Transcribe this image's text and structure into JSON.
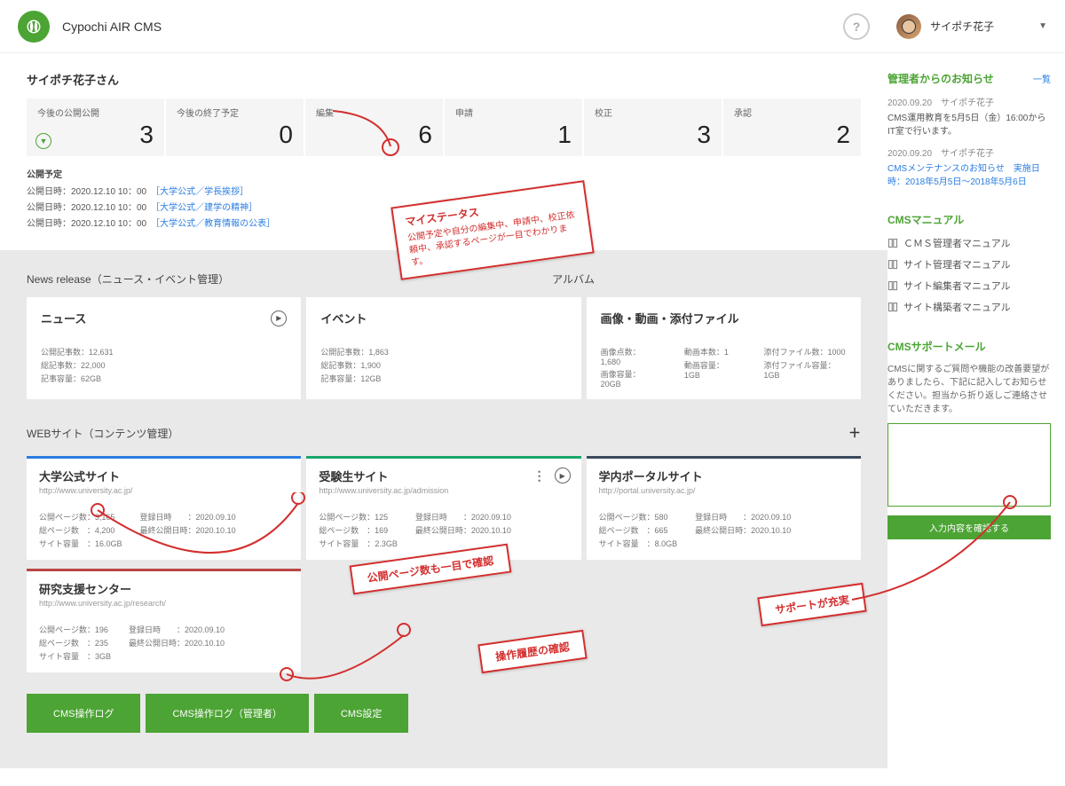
{
  "app_title": "Cypochi AIR CMS",
  "user_name": "サイポチ花子",
  "greeting": "サイポチ花子さん",
  "status": [
    {
      "label": "今後の公開公開",
      "value": "3",
      "arrow": true
    },
    {
      "label": "今後の終了予定",
      "value": "0"
    },
    {
      "label": "編集",
      "value": "6"
    },
    {
      "label": "申請",
      "value": "1"
    },
    {
      "label": "校正",
      "value": "3"
    },
    {
      "label": "承認",
      "value": "2"
    }
  ],
  "pub_title": "公開予定",
  "pub_lines": [
    {
      "dt": "公開日時：2020.12.10 10：00",
      "link": "［大学公式／学長挨拶］"
    },
    {
      "dt": "公開日時：2020.12.10 10：00",
      "link": "［大学公式／建学の精神］"
    },
    {
      "dt": "公開日時：2020.12.10 10：00",
      "link": "［大学公式／教育情報の公表］"
    }
  ],
  "news_section": "News release（ニュース・イベント管理）",
  "album_label": "アルバム",
  "news_card": {
    "title": "ニュース",
    "s1": "公開記事数：12,631",
    "s2": "総記事数：22,000",
    "s3": "記事容量：62GB"
  },
  "event_card": {
    "title": "イベント",
    "s1": "公開記事数：1,863",
    "s2": "総記事数：1,900",
    "s3": "記事容量：12GB"
  },
  "album_card": {
    "title": "画像・動画・添付ファイル",
    "a1": "画像点数：1,680",
    "a2": "画像容量：20GB",
    "b1": "動画本数：1",
    "b2": "動画容量：1GB",
    "c1": "添付ファイル数：1000",
    "c2": "添付ファイル容量：1GB"
  },
  "web_section": "WEBサイト（コンテンツ管理）",
  "sites": [
    {
      "title": "大学公式サイト",
      "url": "http://www.university.ac.jp/",
      "p": "公開ページ数：3,165",
      "t": "総ページ数　：4,200",
      "c": "サイト容量　：16.0GB",
      "r1": "登録日時　　：2020.09.10",
      "r2": "最終公開日時：2020.10.10",
      "color": "blue"
    },
    {
      "title": "受験生サイト",
      "url": "http://www.university.ac.jp/admission",
      "p": "公開ページ数：125",
      "t": "総ページ数　：169",
      "c": "サイト容量　：2.3GB",
      "r1": "登録日時　　：2020.09.10",
      "r2": "最終公開日時：2020.10.10",
      "color": "green",
      "menu": true
    },
    {
      "title": "学内ポータルサイト",
      "url": "http://portal.university.ac.jp/",
      "p": "公開ページ数：580",
      "t": "総ページ数　：665",
      "c": "サイト容量　：8.0GB",
      "r1": "登録日時　　：2020.09.10",
      "r2": "最終公開日時：2020.10.10",
      "color": "dark"
    }
  ],
  "site4": {
    "title": "研究支援センター",
    "url": "http://www.university.ac.jp/research/",
    "p": "公開ページ数：196",
    "t": "総ページ数　：235",
    "c": "サイト容量　：3GB",
    "r1": "登録日時　　：2020.09.10",
    "r2": "最終公開日時：2020.10.10"
  },
  "buttons": {
    "b1": "CMS操作ログ",
    "b2": "CMS操作ログ（管理者）",
    "b3": "CMS設定"
  },
  "side": {
    "notices_title": "管理者からのお知らせ",
    "notices_link": "一覧",
    "n1": {
      "meta": "2020.09.20　サイポチ花子",
      "body": "CMS運用教育を5月5日（金）16:00からIT室で行います。"
    },
    "n2": {
      "meta": "2020.09.20　サイポチ花子",
      "link": "CMSメンテナンスのお知らせ　実施日時：2018年5月5日～2018年5月6日"
    },
    "manual_title": "CMSマニュアル",
    "m1": "ＣＭＳ管理者マニュアル",
    "m2": "サイト管理者マニュアル",
    "m3": "サイト編集者マニュアル",
    "m4": "サイト構築者マニュアル",
    "support_title": "CMSサポートメール",
    "support_text": "CMSに関するご質問や機能の改善要望がありましたら、下記に記入してお知らせください。担当から折り返しご連絡させていただきます。",
    "support_btn": "入力内容を確認する"
  },
  "annot": {
    "a1_title": "マイステータス",
    "a1_body": "公開予定や自分の編集中、申請中、校正依頼中、承認するページが一目でわかります。",
    "a2": "公開ページ数も一目で確認",
    "a3": "操作履歴の確認",
    "a4": "サポートが充実"
  }
}
